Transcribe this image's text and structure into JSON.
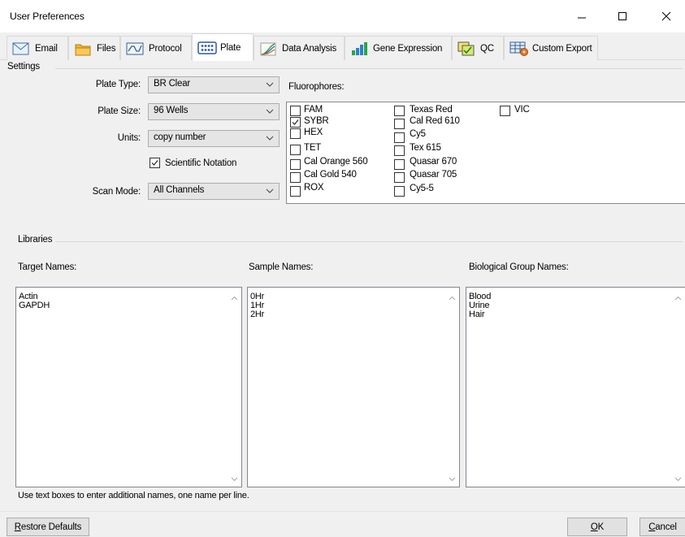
{
  "window": {
    "title": "User Preferences"
  },
  "tabs": [
    {
      "label": "Email",
      "icon": "envelope-icon"
    },
    {
      "label": "Files",
      "icon": "folder-icon"
    },
    {
      "label": "Protocol",
      "icon": "protocol-graph-icon"
    },
    {
      "label": "Plate",
      "icon": "plate-grid-icon",
      "active": true
    },
    {
      "label": "Data Analysis",
      "icon": "data-analysis-curve-icon"
    },
    {
      "label": "Gene Expression",
      "icon": "bar-chart-icon"
    },
    {
      "label": "QC",
      "icon": "qc-icon"
    },
    {
      "label": "Custom Export",
      "icon": "custom-export-icon"
    }
  ],
  "settings": {
    "group_label": "Settings",
    "plate_type": {
      "label": "Plate Type:",
      "value": "BR Clear"
    },
    "plate_size": {
      "label": "Plate Size:",
      "value": "96 Wells"
    },
    "units": {
      "label": "Units:",
      "value": "copy number"
    },
    "scientific_notation": {
      "label": "Scientific Notation",
      "checked": true
    },
    "scan_mode": {
      "label": "Scan Mode:",
      "value": "All Channels"
    },
    "fluorophores_label": "Fluorophores:",
    "fluorophores": [
      {
        "name": "FAM",
        "checked": false
      },
      {
        "name": "SYBR",
        "checked": true
      },
      {
        "name": "HEX",
        "checked": false
      },
      {
        "name": "TET",
        "checked": false
      },
      {
        "name": "Cal Orange 560",
        "checked": false
      },
      {
        "name": "Cal Gold 540",
        "checked": false
      },
      {
        "name": "ROX",
        "checked": false
      },
      {
        "name": "Texas Red",
        "checked": false
      },
      {
        "name": "Cal Red 610",
        "checked": false
      },
      {
        "name": "Cy5",
        "checked": false
      },
      {
        "name": "Tex 615",
        "checked": false
      },
      {
        "name": "Quasar 670",
        "checked": false
      },
      {
        "name": "Quasar 705",
        "checked": false
      },
      {
        "name": "Cy5-5",
        "checked": false
      },
      {
        "name": "VIC",
        "checked": false
      }
    ]
  },
  "libraries": {
    "group_label": "Libraries",
    "target_names": {
      "label": "Target Names:",
      "lines": [
        "Actin",
        "GAPDH"
      ]
    },
    "sample_names": {
      "label": "Sample Names:",
      "lines": [
        "0Hr",
        "1Hr",
        "2Hr"
      ]
    },
    "bio_group_names": {
      "label": "Biological Group Names:",
      "lines": [
        "Blood",
        "Urine",
        "Hair"
      ]
    },
    "hint": "Use text boxes to enter additional names, one name per line."
  },
  "buttons": {
    "restore_defaults": {
      "first": "R",
      "rest": "estore Defaults"
    },
    "ok": {
      "first": "O",
      "rest": "K"
    },
    "cancel": {
      "first": "C",
      "rest": "ancel"
    }
  },
  "colors": {
    "window_bg": "#f0f0f0",
    "control_border": "#adadad",
    "listbox_border": "#828790"
  }
}
